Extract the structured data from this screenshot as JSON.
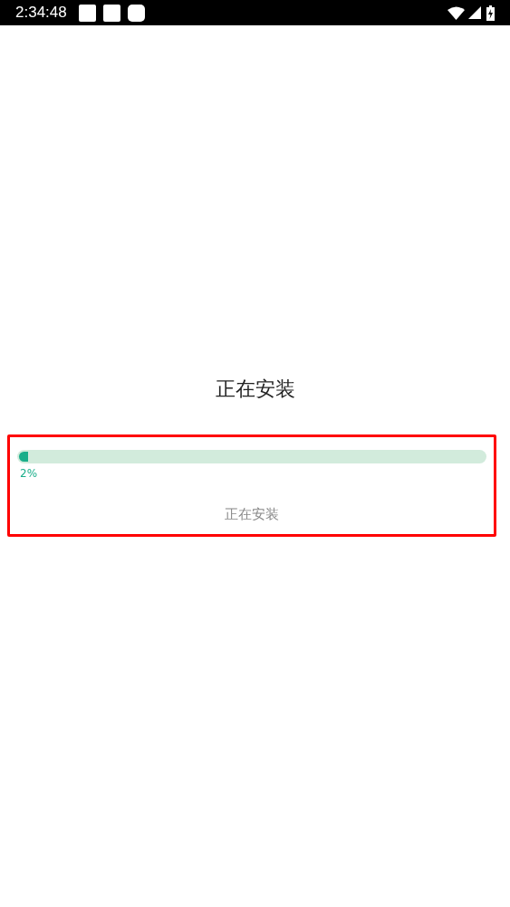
{
  "status_bar": {
    "time": "2:34:48"
  },
  "title": "正在安装",
  "progress": {
    "level": 0.02,
    "reading": "2%",
    "status": "正在安装"
  }
}
